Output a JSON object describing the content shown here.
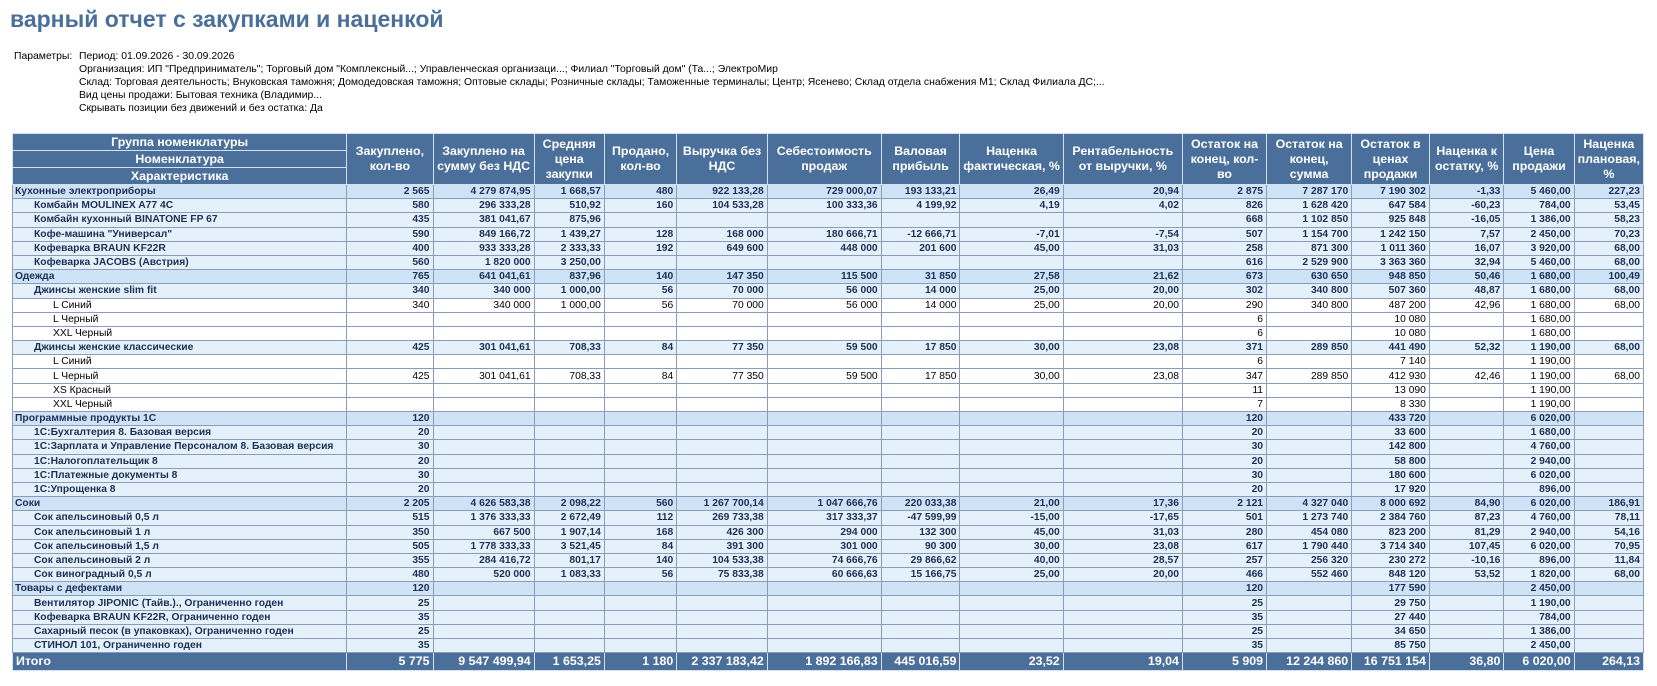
{
  "title": "варный отчет с закупками и наценкой",
  "params": {
    "label": "Параметры:",
    "lines": [
      "Период: 01.09.2026 - 30.09.2026",
      "Организация: ИП \"Предприниматель\"; Торговый дом \"Комплексный...; Управленческая организаци...; Филиал \"Торговый дом\" (Та...; ЭлектроМир",
      "Склад: Торговая деятельность; Внуковская таможня; Домодедовская таможня; Оптовые склады; Розничные склады; Таможенные терминалы; Центр; Ясенево; Склад отдела снабжения М1; Склад Филиала ДС;...",
      "Вид цены продажи: Бытовая техника (Владимир...",
      "Скрывать позиции без движений и без остатка: Да"
    ]
  },
  "columns": {
    "group_headers": [
      "Группа номенклатуры",
      "Номенклатура",
      "Характеристика"
    ],
    "metrics": [
      "Закуплено, кол-во",
      "Закуплено на сумму без НДС",
      "Средняя цена закупки",
      "Продано, кол-во",
      "Выручка без НДС",
      "Себестоимость продаж",
      "Валовая прибыль",
      "Наценка фактическая, %",
      "Рентабельность от выручки, %",
      "Остаток на конец, кол-во",
      "Остаток на конец, сумма",
      "Остаток в ценах продажи",
      "Наценка к остатку, %",
      "Цена продажи",
      "Наценка плановая, %"
    ]
  },
  "rows": [
    {
      "level": 1,
      "name": "Кухонные электроприборы",
      "v": [
        "2 565",
        "4 279 874,95",
        "1 668,57",
        "480",
        "922 133,28",
        "729 000,07",
        "193 133,21",
        "26,49",
        "20,94",
        "2 875",
        "7 287 170",
        "7 190 302",
        "-1,33",
        "5 460,00",
        "227,23"
      ]
    },
    {
      "level": 2,
      "name": "Комбайн MOULINEX  A77 4C",
      "v": [
        "580",
        "296 333,28",
        "510,92",
        "160",
        "104 533,28",
        "100 333,36",
        "4 199,92",
        "4,19",
        "4,02",
        "826",
        "1 628 420",
        "647 584",
        "-60,23",
        "784,00",
        "53,45"
      ]
    },
    {
      "level": 2,
      "name": "Комбайн кухонный BINATONE FP 67",
      "v": [
        "435",
        "381 041,67",
        "875,96",
        "",
        "",
        "",
        "",
        "",
        "",
        "668",
        "1 102 850",
        "925 848",
        "-16,05",
        "1 386,00",
        "58,23"
      ]
    },
    {
      "level": 2,
      "name": "Кофе-машина \"Универсал\"",
      "v": [
        "590",
        "849 166,72",
        "1 439,27",
        "128",
        "168 000",
        "180 666,71",
        "-12 666,71",
        "-7,01",
        "-7,54",
        "507",
        "1 154 700",
        "1 242 150",
        "7,57",
        "2 450,00",
        "70,23"
      ]
    },
    {
      "level": 2,
      "name": "Кофеварка BRAUN KF22R",
      "v": [
        "400",
        "933 333,28",
        "2 333,33",
        "192",
        "649 600",
        "448 000",
        "201 600",
        "45,00",
        "31,03",
        "258",
        "871 300",
        "1 011 360",
        "16,07",
        "3 920,00",
        "68,00"
      ]
    },
    {
      "level": 2,
      "name": "Кофеварка JACOBS (Австрия)",
      "v": [
        "560",
        "1 820 000",
        "3 250,00",
        "",
        "",
        "",
        "",
        "",
        "",
        "616",
        "2 529 900",
        "3 363 360",
        "32,94",
        "5 460,00",
        "68,00"
      ]
    },
    {
      "level": 1,
      "name": "Одежда",
      "v": [
        "765",
        "641 041,61",
        "837,96",
        "140",
        "147 350",
        "115 500",
        "31 850",
        "27,58",
        "21,62",
        "673",
        "630 650",
        "948 850",
        "50,46",
        "1 680,00",
        "100,49"
      ]
    },
    {
      "level": 2,
      "name": "Джинсы женские slim fit",
      "v": [
        "340",
        "340 000",
        "1 000,00",
        "56",
        "70 000",
        "56 000",
        "14 000",
        "25,00",
        "20,00",
        "302",
        "340 800",
        "507 360",
        "48,87",
        "1 680,00",
        "68,00"
      ]
    },
    {
      "level": 3,
      "name": "L Синий",
      "v": [
        "340",
        "340 000",
        "1 000,00",
        "56",
        "70 000",
        "56 000",
        "14 000",
        "25,00",
        "20,00",
        "290",
        "340 800",
        "487 200",
        "42,96",
        "1 680,00",
        "68,00"
      ]
    },
    {
      "level": 3,
      "name": "L Черный",
      "v": [
        "",
        "",
        "",
        "",
        "",
        "",
        "",
        "",
        "",
        "6",
        "",
        "10 080",
        "",
        "1 680,00",
        ""
      ]
    },
    {
      "level": 3,
      "name": "XXL Черный",
      "v": [
        "",
        "",
        "",
        "",
        "",
        "",
        "",
        "",
        "",
        "6",
        "",
        "10 080",
        "",
        "1 680,00",
        ""
      ]
    },
    {
      "level": 2,
      "name": "Джинсы женские классические",
      "v": [
        "425",
        "301 041,61",
        "708,33",
        "84",
        "77 350",
        "59 500",
        "17 850",
        "30,00",
        "23,08",
        "371",
        "289 850",
        "441 490",
        "52,32",
        "1 190,00",
        "68,00"
      ]
    },
    {
      "level": 3,
      "name": "L Синий",
      "v": [
        "",
        "",
        "",
        "",
        "",
        "",
        "",
        "",
        "",
        "6",
        "",
        "7 140",
        "",
        "1 190,00",
        ""
      ]
    },
    {
      "level": 3,
      "name": "L Черный",
      "v": [
        "425",
        "301 041,61",
        "708,33",
        "84",
        "77 350",
        "59 500",
        "17 850",
        "30,00",
        "23,08",
        "347",
        "289 850",
        "412 930",
        "42,46",
        "1 190,00",
        "68,00"
      ]
    },
    {
      "level": 3,
      "name": "XS Красный",
      "v": [
        "",
        "",
        "",
        "",
        "",
        "",
        "",
        "",
        "",
        "11",
        "",
        "13 090",
        "",
        "1 190,00",
        ""
      ]
    },
    {
      "level": 3,
      "name": "XXL Черный",
      "v": [
        "",
        "",
        "",
        "",
        "",
        "",
        "",
        "",
        "",
        "7",
        "",
        "8 330",
        "",
        "1 190,00",
        ""
      ]
    },
    {
      "level": 1,
      "name": "Программные продукты 1С",
      "v": [
        "120",
        "",
        "",
        "",
        "",
        "",
        "",
        "",
        "",
        "120",
        "",
        "433 720",
        "",
        "6 020,00",
        ""
      ]
    },
    {
      "level": 2,
      "name": "1С:Бухгалтерия 8. Базовая версия",
      "v": [
        "20",
        "",
        "",
        "",
        "",
        "",
        "",
        "",
        "",
        "20",
        "",
        "33 600",
        "",
        "1 680,00",
        ""
      ]
    },
    {
      "level": 2,
      "name": "1С:Зарплата и Управление Персоналом 8. Базовая версия",
      "v": [
        "30",
        "",
        "",
        "",
        "",
        "",
        "",
        "",
        "",
        "30",
        "",
        "142 800",
        "",
        "4 760,00",
        ""
      ]
    },
    {
      "level": 2,
      "name": "1С:Налогоплательщик 8",
      "v": [
        "20",
        "",
        "",
        "",
        "",
        "",
        "",
        "",
        "",
        "20",
        "",
        "58 800",
        "",
        "2 940,00",
        ""
      ]
    },
    {
      "level": 2,
      "name": "1С:Платежные документы 8",
      "v": [
        "30",
        "",
        "",
        "",
        "",
        "",
        "",
        "",
        "",
        "30",
        "",
        "180 600",
        "",
        "6 020,00",
        ""
      ]
    },
    {
      "level": 2,
      "name": "1С:Упрощенка 8",
      "v": [
        "20",
        "",
        "",
        "",
        "",
        "",
        "",
        "",
        "",
        "20",
        "",
        "17 920",
        "",
        "896,00",
        ""
      ]
    },
    {
      "level": 1,
      "name": "Соки",
      "v": [
        "2 205",
        "4 626 583,38",
        "2 098,22",
        "560",
        "1 267 700,14",
        "1 047 666,76",
        "220 033,38",
        "21,00",
        "17,36",
        "2 121",
        "4 327 040",
        "8 000 692",
        "84,90",
        "6 020,00",
        "186,91"
      ]
    },
    {
      "level": 2,
      "name": "Сок апельсиновый 0,5 л",
      "v": [
        "515",
        "1 376 333,33",
        "2 672,49",
        "112",
        "269 733,38",
        "317 333,37",
        "-47 599,99",
        "-15,00",
        "-17,65",
        "501",
        "1 273 740",
        "2 384 760",
        "87,23",
        "4 760,00",
        "78,11"
      ]
    },
    {
      "level": 2,
      "name": "Сок апельсиновый 1 л",
      "v": [
        "350",
        "667 500",
        "1 907,14",
        "168",
        "426 300",
        "294 000",
        "132 300",
        "45,00",
        "31,03",
        "280",
        "454 080",
        "823 200",
        "81,29",
        "2 940,00",
        "54,16"
      ]
    },
    {
      "level": 2,
      "name": "Сок апельсиновый 1,5 л",
      "v": [
        "505",
        "1 778 333,33",
        "3 521,45",
        "84",
        "391 300",
        "301 000",
        "90 300",
        "30,00",
        "23,08",
        "617",
        "1 790 440",
        "3 714 340",
        "107,45",
        "6 020,00",
        "70,95"
      ]
    },
    {
      "level": 2,
      "name": "Сок апельсиновый 2 л",
      "v": [
        "355",
        "284 416,72",
        "801,17",
        "140",
        "104 533,38",
        "74 666,76",
        "29 866,62",
        "40,00",
        "28,57",
        "257",
        "256 320",
        "230 272",
        "-10,16",
        "896,00",
        "11,84"
      ]
    },
    {
      "level": 2,
      "name": "Сок виноградный 0,5 л",
      "v": [
        "480",
        "520 000",
        "1 083,33",
        "56",
        "75 833,38",
        "60 666,63",
        "15 166,75",
        "25,00",
        "20,00",
        "466",
        "552 460",
        "848 120",
        "53,52",
        "1 820,00",
        "68,00"
      ]
    },
    {
      "level": 1,
      "name": "Товары с дефектами",
      "v": [
        "120",
        "",
        "",
        "",
        "",
        "",
        "",
        "",
        "",
        "120",
        "",
        "177 590",
        "",
        "2 450,00",
        ""
      ]
    },
    {
      "level": 2,
      "name": "Вентилятор JIPONIC (Тайв.)., Ограниченно годен",
      "v": [
        "25",
        "",
        "",
        "",
        "",
        "",
        "",
        "",
        "",
        "25",
        "",
        "29 750",
        "",
        "1 190,00",
        ""
      ]
    },
    {
      "level": 2,
      "name": "Кофеварка BRAUN KF22R, Ограниченно годен",
      "v": [
        "35",
        "",
        "",
        "",
        "",
        "",
        "",
        "",
        "",
        "35",
        "",
        "27 440",
        "",
        "784,00",
        ""
      ]
    },
    {
      "level": 2,
      "name": "Сахарный песок (в упаковках), Ограниченно годен",
      "v": [
        "25",
        "",
        "",
        "",
        "",
        "",
        "",
        "",
        "",
        "25",
        "",
        "34 650",
        "",
        "1 386,00",
        ""
      ]
    },
    {
      "level": 2,
      "name": "СТИНОЛ 101, Ограниченно годен",
      "v": [
        "35",
        "",
        "",
        "",
        "",
        "",
        "",
        "",
        "",
        "35",
        "",
        "85 750",
        "",
        "2 450,00",
        ""
      ]
    }
  ],
  "total": {
    "label": "Итого",
    "v": [
      "5 775",
      "9 547 499,94",
      "1 653,25",
      "1 180",
      "2 337 183,42",
      "1 892 166,83",
      "445 016,59",
      "23,52",
      "19,04",
      "5 909",
      "12 244 860",
      "16 751 154",
      "36,80",
      "6 020,00",
      "264,13"
    ]
  },
  "colors": {
    "header_bg": "#4a6f9b",
    "group_bg": "#cfe3f7",
    "subgroup_bg": "#e4f1fb",
    "negative": "#d0191b",
    "title": "#4a6f9b"
  }
}
